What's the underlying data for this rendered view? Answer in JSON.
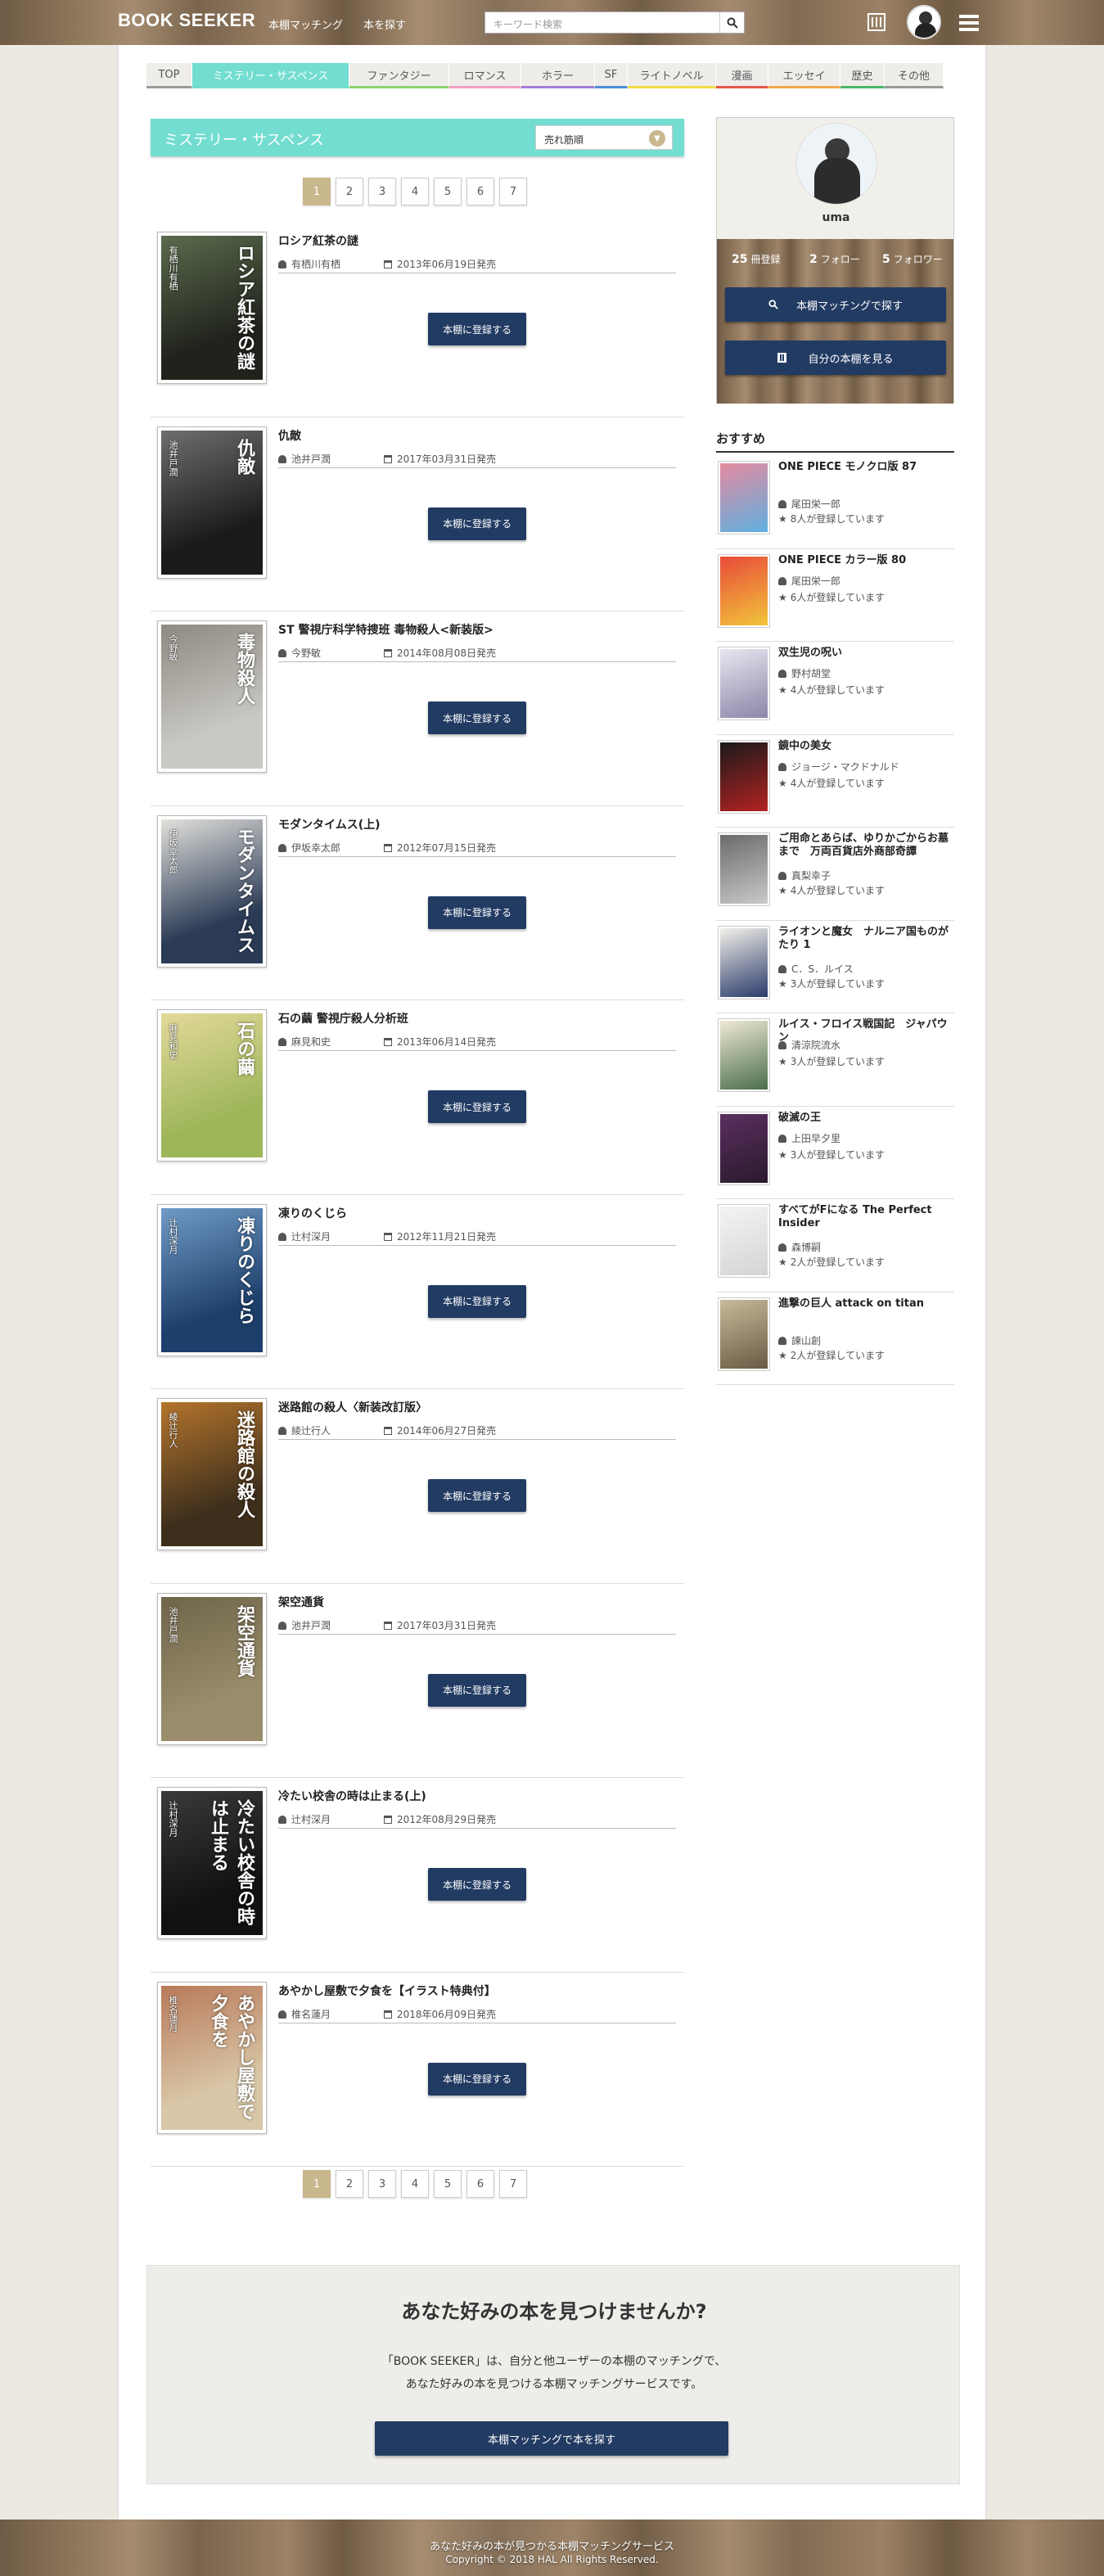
{
  "header": {
    "logo": "BOOK SEEKER",
    "nav": [
      "本棚マッチング",
      "本を探す"
    ],
    "search_placeholder": "キーワード検索"
  },
  "categories": [
    {
      "label": "TOP",
      "color": "#999999"
    },
    {
      "label": "ミステリー・サスペンス",
      "color": "#72ddd0",
      "active": true
    },
    {
      "label": "ファンタジー",
      "color": "#8fd36e"
    },
    {
      "label": "ロマンス",
      "color": "#f19ec2"
    },
    {
      "label": "ホラー",
      "color": "#a27ed6"
    },
    {
      "label": "SF",
      "color": "#4d8fd8"
    },
    {
      "label": "ライトノベル",
      "color": "#f1dc4a"
    },
    {
      "label": "漫画",
      "color": "#e5584a"
    },
    {
      "label": "エッセイ",
      "color": "#f3a64a"
    },
    {
      "label": "歴史",
      "color": "#4bb56a"
    },
    {
      "label": "その他",
      "color": "#999999"
    }
  ],
  "genre": {
    "title": "ミステリー・サスペンス",
    "sort": "売れ筋順"
  },
  "pagination": {
    "pages": [
      "1",
      "2",
      "3",
      "4",
      "5",
      "6",
      "7"
    ],
    "current": "1"
  },
  "books": [
    {
      "title": "ロシア紅茶の謎",
      "author": "有栖川有栖",
      "date": "2013年06月19日発売",
      "button": "本棚に登録する",
      "cover_text": "ロシア紅茶の謎",
      "cover_author": "有栖川有栖",
      "c1": "#20221c",
      "c2": "#5a6b4d"
    },
    {
      "title": "仇敵",
      "author": "池井戸潤",
      "date": "2017年03月31日発売",
      "button": "本棚に登録する",
      "cover_text": "仇敵",
      "cover_author": "池井戸潤",
      "c1": "#1a1a1a",
      "c2": "#6e6e6e"
    },
    {
      "title": "ST 警視庁科学特捜班 毒物殺人<新装版>",
      "author": "今野敏",
      "date": "2014年08月08日発売",
      "button": "本棚に登録する",
      "cover_text": "毒物殺人",
      "cover_author": "今野敏",
      "c1": "#c9c8c4",
      "c2": "#8f8a80"
    },
    {
      "title": "モダンタイムス(上)",
      "author": "伊坂幸太郎",
      "date": "2012年07月15日発売",
      "button": "本棚に登録する",
      "cover_text": "モダンタイムス",
      "cover_author": "伊坂幸太郎",
      "c1": "#2b3a55",
      "c2": "#e2e1dc"
    },
    {
      "title": "石の繭 警視庁殺人分析班",
      "author": "麻見和史",
      "date": "2013年06月14日発売",
      "button": "本棚に登録する",
      "cover_text": "石の繭",
      "cover_author": "麻見和史",
      "c1": "#9eb65a",
      "c2": "#e3d99a"
    },
    {
      "title": "凍りのくじら",
      "author": "辻村深月",
      "date": "2012年11月21日発売",
      "button": "本棚に登録する",
      "cover_text": "凍りのくじら",
      "cover_author": "辻村深月",
      "c1": "#1e3f6b",
      "c2": "#6f9bc6"
    },
    {
      "title": "迷路館の殺人〈新装改訂版〉",
      "author": "綾辻行人",
      "date": "2014年06月27日発売",
      "button": "本棚に登録する",
      "cover_text": "迷路館の殺人",
      "cover_author": "綾辻行人",
      "c1": "#3e2f1c",
      "c2": "#b3742c"
    },
    {
      "title": "架空通貨",
      "author": "池井戸潤",
      "date": "2017年03月31日発売",
      "button": "本棚に登録する",
      "cover_text": "架空通貨",
      "cover_author": "池井戸潤",
      "c1": "#9a8d6c",
      "c2": "#6e6549"
    },
    {
      "title": "冷たい校舎の時は止まる(上)",
      "author": "辻村深月",
      "date": "2012年08月29日発売",
      "button": "本棚に登録する",
      "cover_text": "冷たい校舎の時は止まる",
      "cover_author": "辻村深月",
      "c1": "#111111",
      "c2": "#3a3a3a"
    },
    {
      "title": "あやかし屋敷で夕食を【イラスト特典付】",
      "author": "椎名蓮月",
      "date": "2018年06月09日発売",
      "button": "本棚に登録する",
      "cover_text": "あやかし屋敷で夕食を",
      "cover_author": "椎名蓮月",
      "c1": "#d9c8a8",
      "c2": "#b87a5a"
    }
  ],
  "profile": {
    "name": "uma",
    "stats": [
      {
        "num": "25",
        "label": "冊登録"
      },
      {
        "num": "2",
        "label": "フォロー"
      },
      {
        "num": "5",
        "label": "フォロワー"
      }
    ],
    "match_button": "本棚マッチングで探す",
    "shelf_button": "自分の本棚を見る"
  },
  "recommend": {
    "heading": "おすすめ",
    "items": [
      {
        "title": "ONE PIECE モノクロ版 87",
        "author": "尾田栄一郎",
        "count": "8人が登録しています",
        "c1": "#e58aa0",
        "c2": "#5fb0e0"
      },
      {
        "title": "ONE PIECE カラー版 80",
        "author": "尾田栄一郎",
        "count": "6人が登録しています",
        "c1": "#e84b3a",
        "c2": "#f2c43a"
      },
      {
        "title": "双生児の呪い",
        "author": "野村胡堂",
        "count": "4人が登録しています",
        "c1": "#e9e6f0",
        "c2": "#8a86a8"
      },
      {
        "title": "鏡中の美女",
        "author": "ジョージ・マクドナルド",
        "count": "4人が登録しています",
        "c1": "#1a1a1a",
        "c2": "#b52222"
      },
      {
        "title": "ご用命とあらば、ゆりかごからお墓まで　万両百貨店外商部奇譚",
        "author": "真梨幸子",
        "count": "4人が登録しています",
        "c1": "#6b6b6b",
        "c2": "#c9c9c9"
      },
      {
        "title": "ライオンと魔女　ナルニア国ものがたり 1",
        "author": "C．S．ルイス",
        "count": "3人が登録しています",
        "c1": "#f3f1ea",
        "c2": "#2a3a6a"
      },
      {
        "title": "ルイス・フロイス戦国記　ジャパウン",
        "author": "清涼院流水",
        "count": "3人が登録しています",
        "c1": "#efe9d6",
        "c2": "#4a6d4a"
      },
      {
        "title": "破滅の王",
        "author": "上田早夕里",
        "count": "3人が登録しています",
        "c1": "#5a2f5e",
        "c2": "#2a1a2e"
      },
      {
        "title": "すべてがFになる The Perfect Insider",
        "author": "森博嗣",
        "count": "2人が登録しています",
        "c1": "#f4f4f4",
        "c2": "#d4d4d4"
      },
      {
        "title": "進撃の巨人 attack on titan",
        "author": "諫山創",
        "count": "2人が登録しています",
        "c1": "#c9b99a",
        "c2": "#6a5a44"
      }
    ]
  },
  "cta": {
    "heading": "あなた好みの本を見つけませんか?",
    "line1": "「BOOK SEEKER」は、自分と他ユーザーの本棚のマッチングで、",
    "line2": "あなた好みの本を見つける本棚マッチングサービスです。",
    "button": "本棚マッチングで本を探す"
  },
  "footer": {
    "line1": "あなた好みの本が見つかる本棚マッチングサービス",
    "line2": "Copyright © 2018 HAL All Rights Reserved."
  }
}
